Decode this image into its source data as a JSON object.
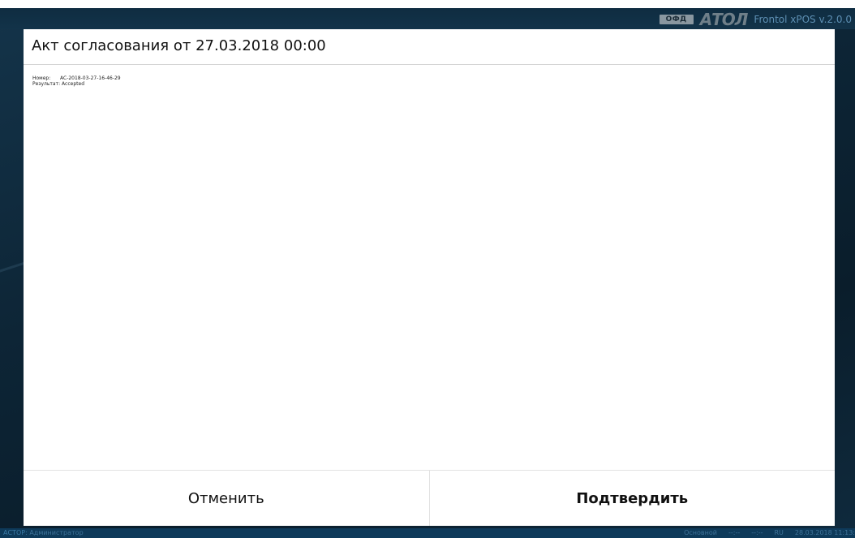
{
  "app": {
    "ofd_badge": "ОФД",
    "logo_text": "АТОЛ",
    "version": "Frontol xPOS v.2.0.0"
  },
  "dialog": {
    "title": "Акт согласования от 27.03.2018 00:00",
    "details": [
      {
        "label": "Номер:",
        "value": "AC-2018-03-27-16-46-29"
      },
      {
        "label": "Результат:",
        "value": "Accepted"
      }
    ],
    "cancel_label": "Отменить",
    "confirm_label": "Подтвердить"
  },
  "status_bar": {
    "user_prefix": "АСТОР:",
    "user_name": "Администратор",
    "mode": "Основной",
    "field1": "--:--",
    "field2": "--:--",
    "language": "RU",
    "datetime": "28.03.2018 11:13:"
  }
}
